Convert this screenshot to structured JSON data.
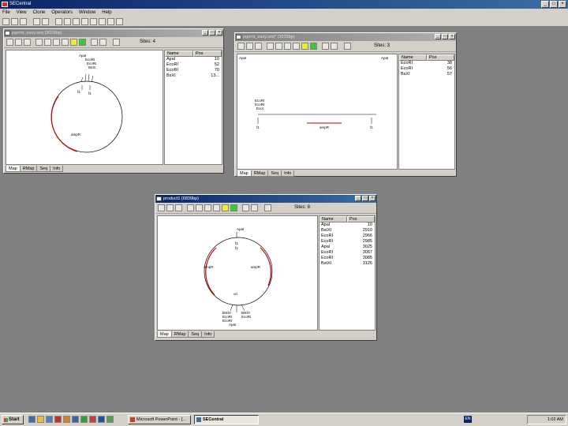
{
  "app": {
    "title": "SECentral",
    "menu": [
      "File",
      "View",
      "Clone",
      "Operators",
      "Window",
      "Help"
    ]
  },
  "windows": [
    {
      "title": "pgemt_easy.seq (3015bp)",
      "sites_label": "Sites: 4",
      "columns": [
        "Name",
        "Pos"
      ],
      "rows": [
        [
          "ApaI",
          "10"
        ],
        [
          "EcoRI",
          "52"
        ],
        [
          "EcoRI",
          "70"
        ],
        [
          "BsXI",
          "13..."
        ]
      ],
      "map_labels": [
        "ApaI",
        "EcoRI",
        "EcoRI",
        "BsXI",
        "f1",
        "f1",
        "ampR"
      ],
      "tabs": [
        "Map",
        "RMap",
        "Seq",
        "Info"
      ]
    },
    {
      "title": "pgemt_easy.seq* (3015bp)",
      "sites_label": "Sites: 3",
      "columns": [
        "Name",
        "Pos"
      ],
      "rows": [
        [
          "EcoRI",
          "38"
        ],
        [
          "EcoRI",
          "56"
        ],
        [
          "BsXI",
          "57"
        ]
      ],
      "map_labels": [
        "ApaI",
        "ApaI",
        "EcoRI",
        "EcoRI",
        "EcoI",
        "f1",
        "ampR",
        "f1"
      ],
      "tabs": [
        "Map",
        "RMap",
        "Seq",
        "Info"
      ]
    },
    {
      "title": "product1 (6839bp)",
      "sites_label": "Sites: 8",
      "columns": [
        "Name",
        "Pos"
      ],
      "rows": [
        [
          "ApaI",
          "10"
        ],
        [
          "BstXI",
          "2910"
        ],
        [
          "EcoRI",
          "2966"
        ],
        [
          "EcoRI",
          "2985"
        ],
        [
          "ApaI",
          "3025"
        ],
        [
          "EcoRI",
          "3067"
        ],
        [
          "EcoRI",
          "3085"
        ],
        [
          "BstXI",
          "3126"
        ]
      ],
      "map_labels": [
        "ApaI",
        "f1",
        "f1",
        "AmpR",
        "ampR",
        "ori",
        "BstXI",
        "EcoRI",
        "EcoRI",
        "ApaI",
        "BstXI",
        "EcoRI"
      ],
      "tabs": [
        "Map",
        "RMap",
        "Seq",
        "Info"
      ]
    }
  ],
  "taskbar": {
    "start_label": "Start",
    "tasks": [
      "Microsoft PowerPoint - [...",
      "SECentral"
    ],
    "lang": "EN",
    "clock": "1:02 AM"
  }
}
